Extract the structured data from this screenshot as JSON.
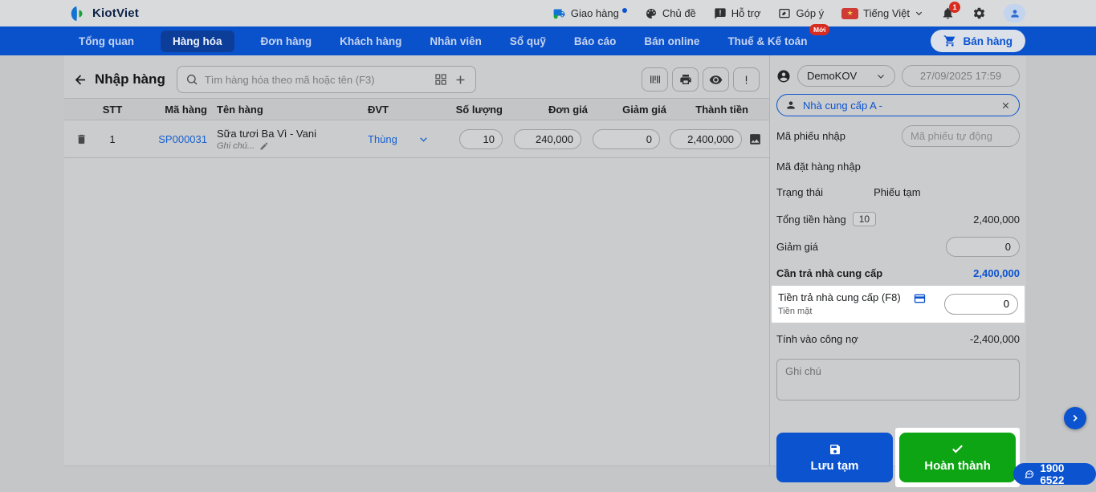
{
  "topbar": {
    "brand": "KiotViet",
    "delivery": "Giao hàng",
    "theme": "Chủ đề",
    "support": "Hỗ trợ",
    "feedback": "Góp ý",
    "language": "Tiếng Việt",
    "flag_star": "★",
    "bell_badge": "1"
  },
  "nav": {
    "items": [
      "Tổng quan",
      "Hàng hóa",
      "Đơn hàng",
      "Khách hàng",
      "Nhân viên",
      "Sổ quỹ",
      "Báo cáo",
      "Bán online",
      "Thuế & Kế toán"
    ],
    "new_badge": "Mới",
    "sell_button": "Bán hàng"
  },
  "main": {
    "title": "Nhập hàng",
    "search_placeholder": "Tìm hàng hóa theo mã hoặc tên (F3)",
    "table": {
      "headers": [
        "STT",
        "Mã hàng",
        "Tên hàng",
        "ĐVT",
        "Số lượng",
        "Đơn giá",
        "Giảm giá",
        "Thành tiền"
      ],
      "row": {
        "stt": "1",
        "code": "SP000031",
        "name": "Sữa tươi Ba Vì - Vani",
        "note": "Ghi chú...",
        "unit": "Thùng",
        "qty": "10",
        "price": "240,000",
        "discount": "0",
        "total": "2,400,000"
      }
    }
  },
  "sidebar": {
    "branch": "DemoKOV",
    "datetime": "27/09/2025 17:59",
    "supplier": "Nhà cung cấp A -",
    "receipt_code_label": "Mã phiếu nhập",
    "receipt_code_placeholder": "Mã phiếu tự động",
    "order_code_label": "Mã đặt hàng nhập",
    "status_label": "Trạng thái",
    "status_value": "Phiếu tạm",
    "total_label": "Tổng tiền hàng",
    "total_qty": "10",
    "total_value": "2,400,000",
    "discount_label": "Giảm giá",
    "discount_value": "0",
    "payable_label": "Cần trả nhà cung cấp",
    "payable_value": "2,400,000",
    "pay_label": "Tiền trả nhà cung cấp (F8)",
    "pay_method": "Tiền mặt",
    "pay_value": "0",
    "debt_label": "Tính vào công nợ",
    "debt_value": "-2,400,000",
    "note_placeholder": "Ghi chú",
    "save_draft": "Lưu tạm",
    "complete": "Hoàn thành"
  },
  "floating": {
    "hotline": "1900 6522"
  },
  "colors": {
    "accent": "#0b53cf",
    "green": "#0da513",
    "alert": "#d82c20",
    "link": "#1560cd"
  }
}
